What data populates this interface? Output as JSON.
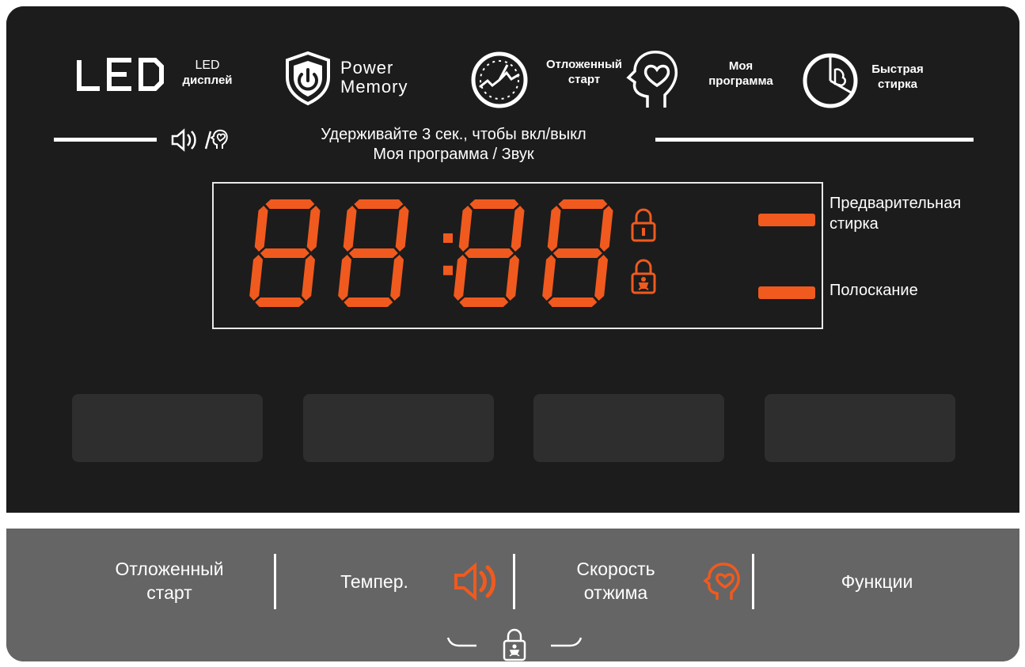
{
  "features": {
    "led": {
      "logo_text": "LED",
      "line1": "LED",
      "line2": "дисплей"
    },
    "power_memory": {
      "line1": "Power",
      "line2": "Memory"
    },
    "delay_start": {
      "line1": "Отложенный",
      "line2": "старт"
    },
    "my_program": {
      "line1": "Моя",
      "line2": "программа"
    },
    "quick_wash": {
      "line1": "Быстрая",
      "line2": "стирка"
    }
  },
  "hint": {
    "line1": "Удерживайте 3 сек., чтобы вкл/выкл",
    "line2": "Моя программа / Звук",
    "icons": "sound-icon / heart-head-icon"
  },
  "display": {
    "digits": "88:88",
    "segment_color": "#f05a1e",
    "icons": [
      "lock-icon",
      "child-lock-icon"
    ]
  },
  "indicators": {
    "prewash": "Предварительная стирка",
    "rinse": "Полоскание"
  },
  "buttons": [
    {
      "line1": "Отложенный",
      "line2": "старт"
    },
    {
      "line1": "Темпер.",
      "secondary_icon": "sound-icon"
    },
    {
      "line1": "Скорость",
      "line2": "отжима",
      "secondary_icon": "heart-head-icon"
    },
    {
      "line1": "Функции"
    }
  ],
  "child_lock_combo": {
    "icon": "child-lock-icon"
  },
  "colors": {
    "accent": "#f05a1e",
    "panel": "#1c1c1c",
    "button_strip": "#656565"
  }
}
